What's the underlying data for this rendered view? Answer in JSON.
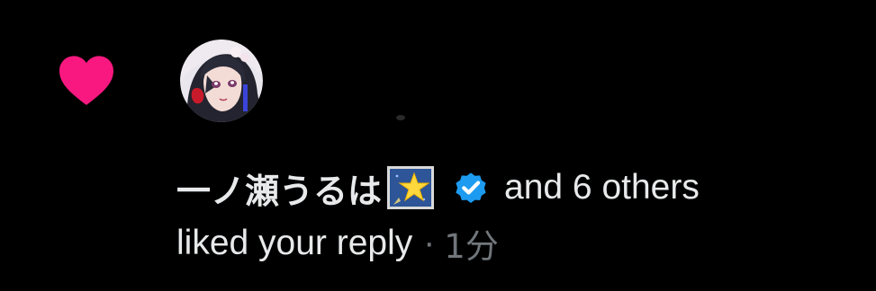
{
  "notification": {
    "username": "一ノ瀬うるは",
    "others_text": "and 6 others",
    "action_text": "liked your reply",
    "separator": "·",
    "time": "1分"
  },
  "icons": {
    "like": "heart-icon",
    "avatar": "user-avatar",
    "emoji": "star-emoji",
    "verified": "verified-badge-icon"
  },
  "colors": {
    "heart": "#f91880",
    "verified": "#1d9bf0",
    "primary_text": "#e7e9ea",
    "secondary_text": "#71767b",
    "background": "#000000"
  }
}
